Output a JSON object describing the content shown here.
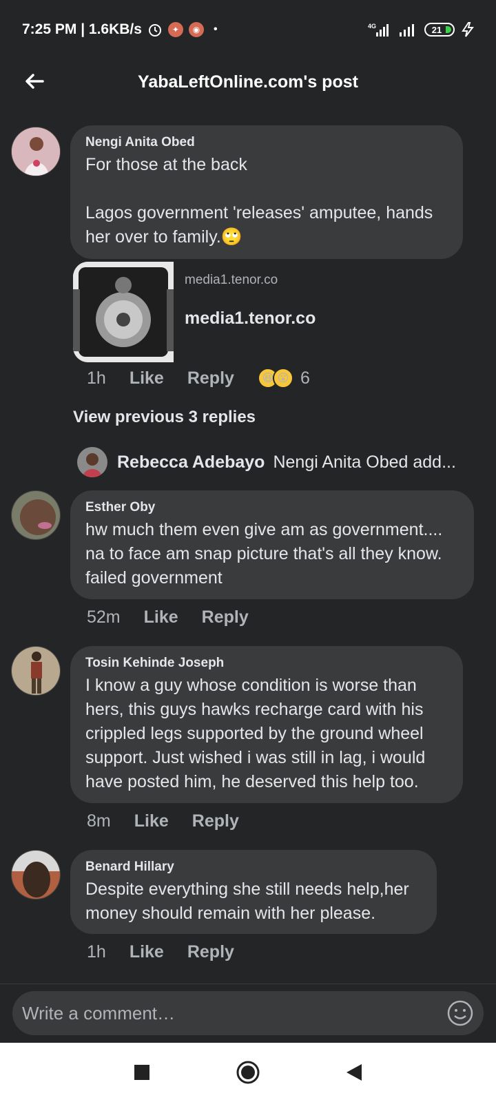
{
  "status_bar": {
    "time_speed": "7:25 PM | 1.6KB/s",
    "network": "4G",
    "battery": "21",
    "icons": [
      "alarm-icon",
      "twitter-notification-icon",
      "whatsapp-notification-icon",
      "signal-icon",
      "battery-icon",
      "charging-icon"
    ]
  },
  "header": {
    "title": "YabaLeftOnline.com's post",
    "back_icon": "arrow-left-icon"
  },
  "comments": [
    {
      "author": "Nengi Anita Obed",
      "text": "For those at the back\n\nLagos government 'releases' amputee, hands her over to family.🙄",
      "link_preview": {
        "domain_small": "media1.tenor.co",
        "domain_big": "media1.tenor.co"
      },
      "time": "1h",
      "like": "Like",
      "reply": "Reply",
      "reaction_count": "6",
      "reactions": [
        "😆",
        "😮"
      ]
    },
    {
      "author": "Esther Oby",
      "text": "hw much them even give am as government.... na to face am snap picture that's all they know. failed government",
      "time": "52m",
      "like": "Like",
      "reply": "Reply"
    },
    {
      "author": "Tosin Kehinde Joseph",
      "text": "I know a guy whose condition is worse than hers, this guys hawks recharge card with his crippled legs supported by the ground wheel support. Just wished i was still in lag, i would have posted him, he deserved this help too.",
      "time": "8m",
      "like": "Like",
      "reply": "Reply"
    },
    {
      "author": "Benard Hillary",
      "text": "Despite everything she still needs help,her money should remain with her please.",
      "time": "1h",
      "like": "Like",
      "reply": "Reply"
    }
  ],
  "replies_section": {
    "view_previous": "View previous 3 replies",
    "preview_author": "Rebecca Adebayo",
    "preview_snippet": "Nengi Anita Obed add..."
  },
  "composer": {
    "placeholder": "Write a comment…",
    "emoji_icon": "smiley-icon"
  },
  "nav_bar": {
    "icons": [
      "recents-square-icon",
      "home-circle-icon",
      "back-triangle-icon"
    ]
  }
}
